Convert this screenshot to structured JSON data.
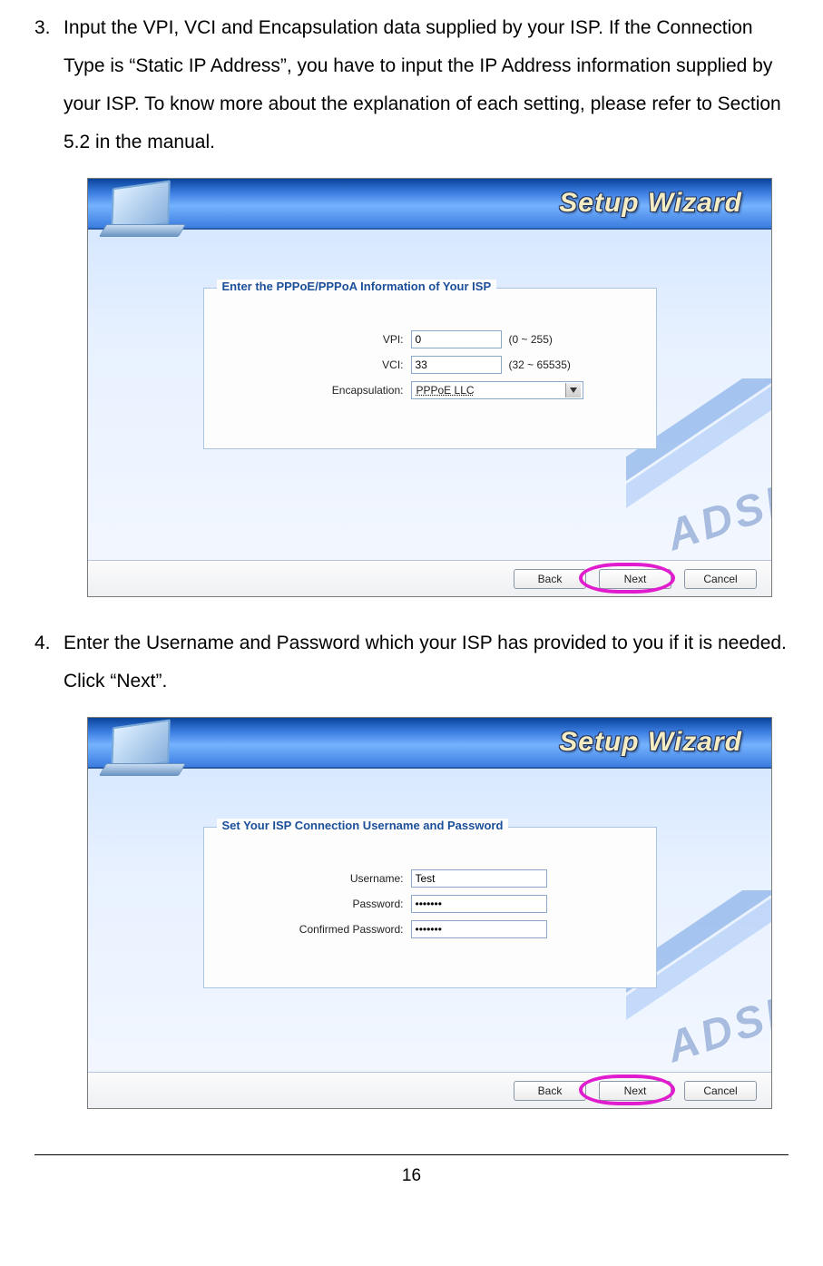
{
  "steps": {
    "s3": {
      "num": "3.",
      "text": "Input the VPI, VCI and Encapsulation data supplied by your ISP. If the Connection Type is “Static IP Address”, you have to input the IP Address information supplied by your ISP. To know more about the explanation of each setting, please refer to Section 5.2 in the manual."
    },
    "s4": {
      "num": "4.",
      "text": "Enter the Username and Password which your ISP has provided to you if it is needed. Click “Next”."
    }
  },
  "wizard": {
    "title": "Setup Wizard",
    "watermark": "ADSL",
    "buttons": {
      "back": "Back",
      "next": "Next",
      "cancel": "Cancel"
    }
  },
  "panel1": {
    "title": "Enter the PPPoE/PPPoA Information of Your ISP",
    "vpi_label": "VPI:",
    "vpi_value": "0",
    "vpi_range": "(0 ~ 255)",
    "vci_label": "VCI:",
    "vci_value": "33",
    "vci_range": "(32 ~ 65535)",
    "encap_label": "Encapsulation:",
    "encap_value": "PPPoE LLC"
  },
  "panel2": {
    "title": "Set Your ISP Connection Username and Password",
    "user_label": "Username:",
    "user_value": "Test",
    "pass_label": "Password:",
    "pass_value": "•••••••",
    "confirm_label": "Confirmed Password:",
    "confirm_value": "•••••••"
  },
  "page_number": "16"
}
